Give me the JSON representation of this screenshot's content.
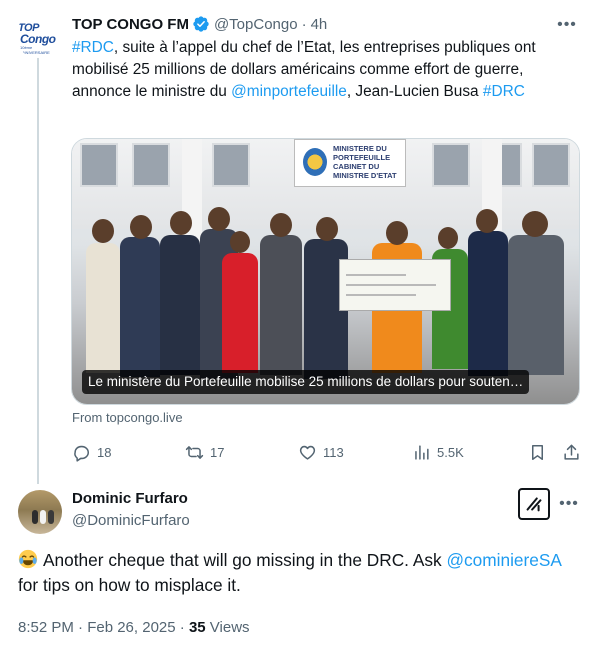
{
  "tweet": {
    "author_name": "TOP CONGO FM",
    "handle": "@TopCongo",
    "separator": "·",
    "time": "4h",
    "more_label": "•••",
    "text_parts": [
      {
        "t": "#RDC",
        "link": true
      },
      {
        "t": ", suite à l’appel du chef de l’Etat, les entreprises publiques ont mobilisé 25 millions de dollars américains comme effort de guerre, annonce le ministre du ",
        "link": false
      },
      {
        "t": "@minportefeuille",
        "link": true
      },
      {
        "t": ", Jean-Lucien Busa ",
        "link": false
      },
      {
        "t": "#DRC",
        "link": true
      }
    ],
    "avatar_logo": {
      "line1": "TOP",
      "line2": "Congo",
      "line3": "10ème ANNIVERSAIRE"
    },
    "card": {
      "sign_text": "MINISTERE DU PORTEFEUILLE CABINET DU MINISTRE D'ETAT",
      "caption": "Le ministère du Portefeuille mobilise 25 millions de dollars pour souten…",
      "source": "From topcongo.live"
    },
    "actions": {
      "replies": "18",
      "reposts": "17",
      "likes": "113",
      "views": "5.5K"
    }
  },
  "reply": {
    "author_name": "Dominic Furfaro",
    "handle": "@DominicFurfaro",
    "more_label": "•••",
    "emoji": "joy-emoji",
    "text_before": "Another cheque that will go missing in the DRC. Ask ",
    "mention": "@cominiereSA",
    "text_after": " for tips on how to misplace it.",
    "timestamp": "8:52 PM · Feb 26, 2025 · ",
    "views_count": "35",
    "views_label": " Views"
  },
  "colors": {
    "link": "#1d9bf0",
    "secondary_text": "#536471",
    "primary_text": "#0f1419",
    "thread_line": "#cfd9de"
  }
}
